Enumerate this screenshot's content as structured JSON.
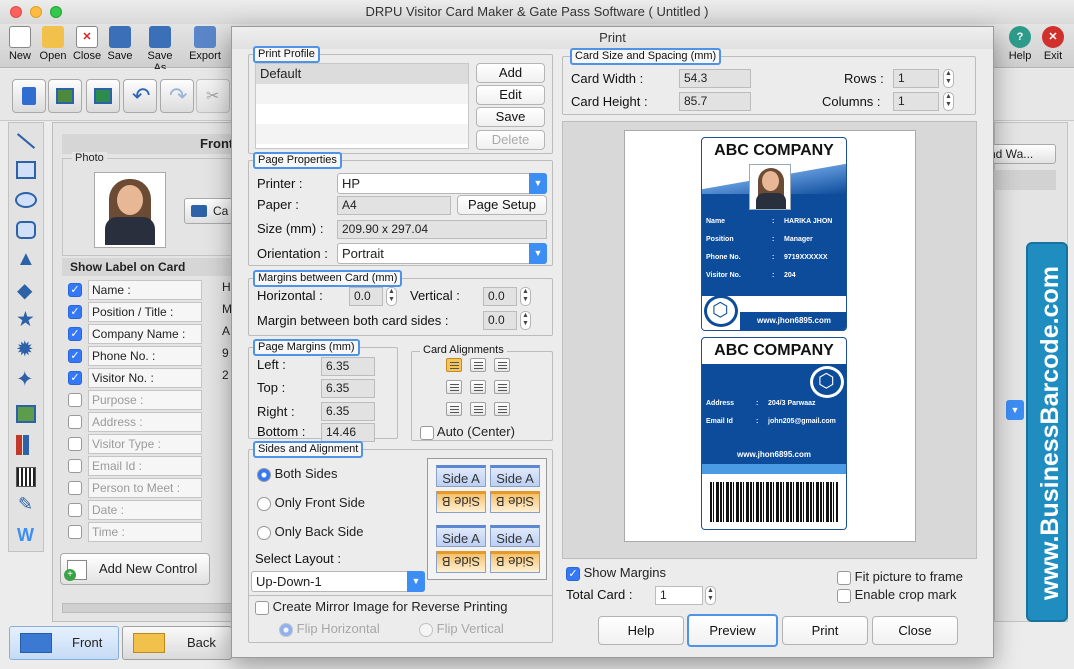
{
  "app": {
    "title": "DRPU Visitor Card Maker & Gate Pass Software ( Untitled )",
    "toolbar": [
      {
        "label": "New",
        "color": "#ffffff"
      },
      {
        "label": "Open",
        "color": "#f2c14b"
      },
      {
        "label": "Close",
        "color": "#ffffff"
      },
      {
        "label": "Save",
        "color": "#3b6fb8"
      },
      {
        "label": "Save As",
        "color": "#3b6fb8"
      },
      {
        "label": "Export",
        "color": "#5a86c9"
      }
    ],
    "help_label": "Help",
    "exit_label": "Exit"
  },
  "left_panel": {
    "front_label": "Front",
    "photo_label": "Photo",
    "camera_label": "Ca",
    "show_label_title": "Show Label on Card",
    "labels": [
      {
        "text": "Name :",
        "checked": true
      },
      {
        "text": "Position / Title :",
        "checked": true
      },
      {
        "text": "Company Name :",
        "checked": true
      },
      {
        "text": "Phone No. :",
        "checked": true
      },
      {
        "text": "Visitor No. :",
        "checked": true
      },
      {
        "text": "Purpose :",
        "checked": false
      },
      {
        "text": "Address :",
        "checked": false
      },
      {
        "text": "Visitor Type :",
        "checked": false
      },
      {
        "text": "Email Id :",
        "checked": false
      },
      {
        "text": "Person to Meet :",
        "checked": false
      },
      {
        "text": "Date :",
        "checked": false
      },
      {
        "text": "Time :",
        "checked": false
      }
    ],
    "value_initials": [
      "H",
      "M",
      "A",
      "9",
      "2"
    ],
    "add_control_label": "Add New Control",
    "front_tab": "Front",
    "back_tab": "Back",
    "right_button": "nd Wa..."
  },
  "dialog": {
    "title": "Print",
    "print_profile": {
      "title": "Print Profile",
      "items": [
        "Default"
      ],
      "add": "Add",
      "edit": "Edit",
      "save": "Save",
      "delete": "Delete"
    },
    "page_properties": {
      "title": "Page Properties",
      "printer_label": "Printer :",
      "printer": "HP",
      "paper_label": "Paper :",
      "paper": "A4",
      "page_setup": "Page Setup",
      "size_label": "Size (mm) :",
      "size": "209.90 x 297.04",
      "orientation_label": "Orientation :",
      "orientation": "Portrait"
    },
    "margins_between": {
      "title": "Margins between Card (mm)",
      "horizontal_label": "Horizontal :",
      "horizontal": "0.0",
      "vertical_label": "Vertical :",
      "vertical": "0.0",
      "both_label": "Margin between both card sides :",
      "both": "0.0"
    },
    "page_margins": {
      "title": "Page Margins (mm)",
      "left_label": "Left :",
      "left": "6.35",
      "top_label": "Top :",
      "top": "6.35",
      "right_label": "Right :",
      "right": "6.35",
      "bottom_label": "Bottom :",
      "bottom": "14.46"
    },
    "card_alignments": {
      "title": "Card Alignments",
      "auto_center": "Auto (Center)"
    },
    "sides": {
      "title": "Sides and Alignment",
      "both": "Both Sides",
      "front_only": "Only Front Side",
      "back_only": "Only Back Side",
      "select_layout": "Select Layout :",
      "layout": "Up-Down-1",
      "side_a": "Side A",
      "side_b": "Side B"
    },
    "mirror": {
      "label": "Create Mirror Image for Reverse Printing",
      "flip_h": "Flip Horizontal",
      "flip_v": "Flip Vertical"
    },
    "card_size": {
      "title": "Card Size and Spacing (mm)",
      "width_label": "Card Width :",
      "width": "54.3",
      "height_label": "Card Height :",
      "height": "85.7",
      "rows_label": "Rows :",
      "rows": "1",
      "columns_label": "Columns :",
      "columns": "1"
    },
    "preview_card": {
      "company": "ABC COMPANY",
      "front_rows": [
        {
          "k": "Name",
          "v": "HARIKA JHON"
        },
        {
          "k": "Position",
          "v": "Manager"
        },
        {
          "k": "Phone No.",
          "v": "9719XXXXXX"
        },
        {
          "k": "Visitor No.",
          "v": "204"
        }
      ],
      "website": "www.jhon6895.com",
      "back_rows": [
        {
          "k": "Address",
          "v": "204/3 Parwaaz"
        },
        {
          "k": "Email Id",
          "v": "john205@gmail.com"
        }
      ]
    },
    "show_margins": "Show Margins",
    "total_card_label": "Total Card :",
    "total_card": "1",
    "fit_picture": "Fit picture to frame",
    "crop_mark": "Enable crop mark",
    "buttons": {
      "help": "Help",
      "preview": "Preview",
      "print": "Print",
      "close": "Close"
    }
  },
  "watermark": "www.BusinessBarcode.com",
  "colors": {
    "accent": "#3d8ef4",
    "card_blue": "#0d4c9b",
    "watermark": "#1f8dbf"
  }
}
